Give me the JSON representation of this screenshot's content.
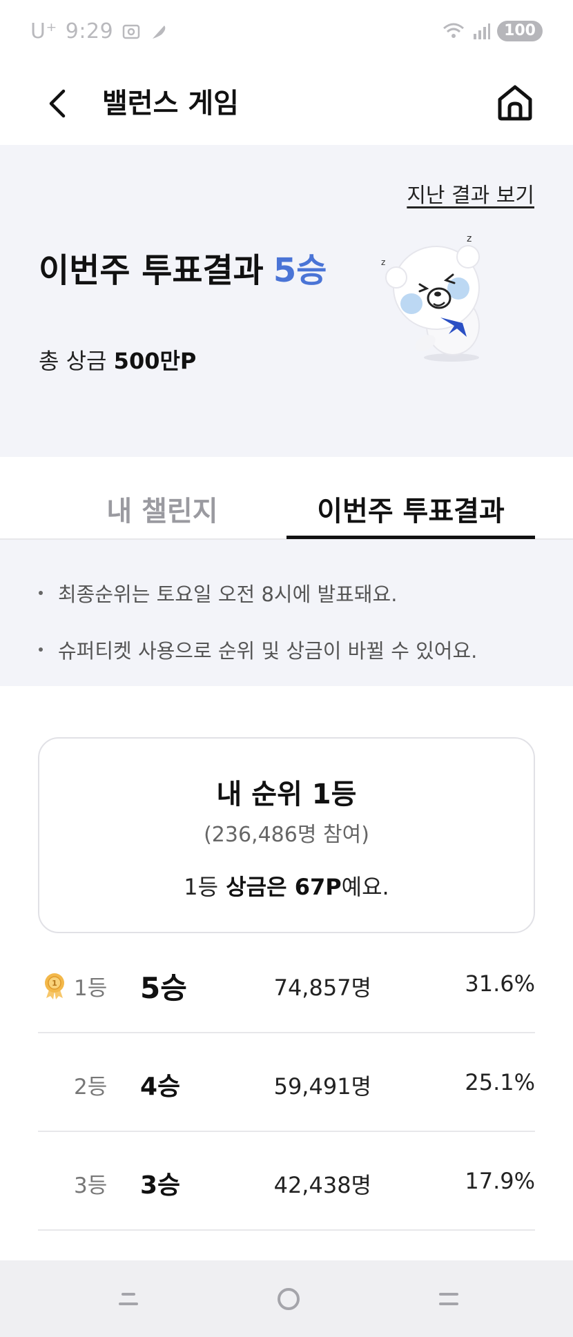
{
  "status_bar": {
    "carrier": "U⁺",
    "time": "9:29",
    "battery": "100",
    "left_icons": [
      "screenshot-icon",
      "feather-icon"
    ],
    "right_icons": [
      "wifi-icon",
      "signal-icon"
    ]
  },
  "header": {
    "title": "밸런스 게임",
    "back_icon": "chevron-left-icon",
    "home_icon": "home-icon"
  },
  "hero": {
    "past_results_link": "지난 결과 보기",
    "title": "이번주 투표결과",
    "wins": "5승",
    "prize_label": "총 상금",
    "prize_value": "500만P",
    "mascot": "bear-mascot"
  },
  "tabs": [
    {
      "label": "내 챌린지",
      "active": false
    },
    {
      "label": "이번주 투표결과",
      "active": true
    }
  ],
  "notices": [
    "최종순위는 토요일 오전 8시에 발표돼요.",
    "슈퍼티켓 사용으로 순위 및 상금이 바뀔 수 있어요."
  ],
  "rank_card": {
    "title": "내 순위 1등",
    "participants": "(236,486명 참여)",
    "prize_prefix": "1등",
    "prize_mid": " 상금은 ",
    "prize_value": "67P",
    "prize_suffix": "예요."
  },
  "results": [
    {
      "rank": "1등",
      "wins": "5승",
      "count": "74,857명",
      "pct": "31.6%",
      "medal": true
    },
    {
      "rank": "2등",
      "wins": "4승",
      "count": "59,491명",
      "pct": "25.1%",
      "medal": false
    },
    {
      "rank": "3등",
      "wins": "3승",
      "count": "42,438명",
      "pct": "17.9%",
      "medal": false
    }
  ],
  "nav": [
    "recent-apps-icon",
    "home-circle-icon",
    "back-icon"
  ],
  "colors": {
    "accent_blue": "#4a74d6",
    "hero_bg": "#f3f4f9",
    "muted": "#9a9aa0",
    "medal_gold": "#f0b43a"
  }
}
